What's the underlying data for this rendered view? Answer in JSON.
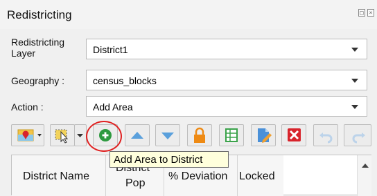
{
  "panel": {
    "title": "Redistricting"
  },
  "form": {
    "layer_label_line1": "Redistricting",
    "layer_label_line2": "Layer",
    "layer_value": "District1",
    "geography_label": "Geography :",
    "geography_value": "census_blocks",
    "action_label": "Action :",
    "action_value": "Add Area"
  },
  "toolbar": {
    "icons": [
      "map-pin-icon",
      "select-features-icon",
      "dropdown-arrow-icon",
      "add-area-icon",
      "move-up-icon",
      "move-down-icon",
      "lock-icon",
      "table-icon",
      "edit-document-icon",
      "delete-icon",
      "undo-icon",
      "redo-icon"
    ]
  },
  "tooltip": {
    "text": "Add Area to District"
  },
  "table": {
    "columns": [
      "District Name",
      "District Pop",
      "% Deviation",
      "Locked"
    ],
    "col2_line1": "District",
    "col2_line2": "Pop"
  },
  "colors": {
    "add_green": "#2e9a40",
    "arrow_blue": "#5aa0dc",
    "lock_orange": "#ee8a14",
    "delete_red": "#d8242c",
    "table_green": "#3aa34a",
    "highlight": "#e02020",
    "tooltip_bg": "#ffffdc"
  }
}
